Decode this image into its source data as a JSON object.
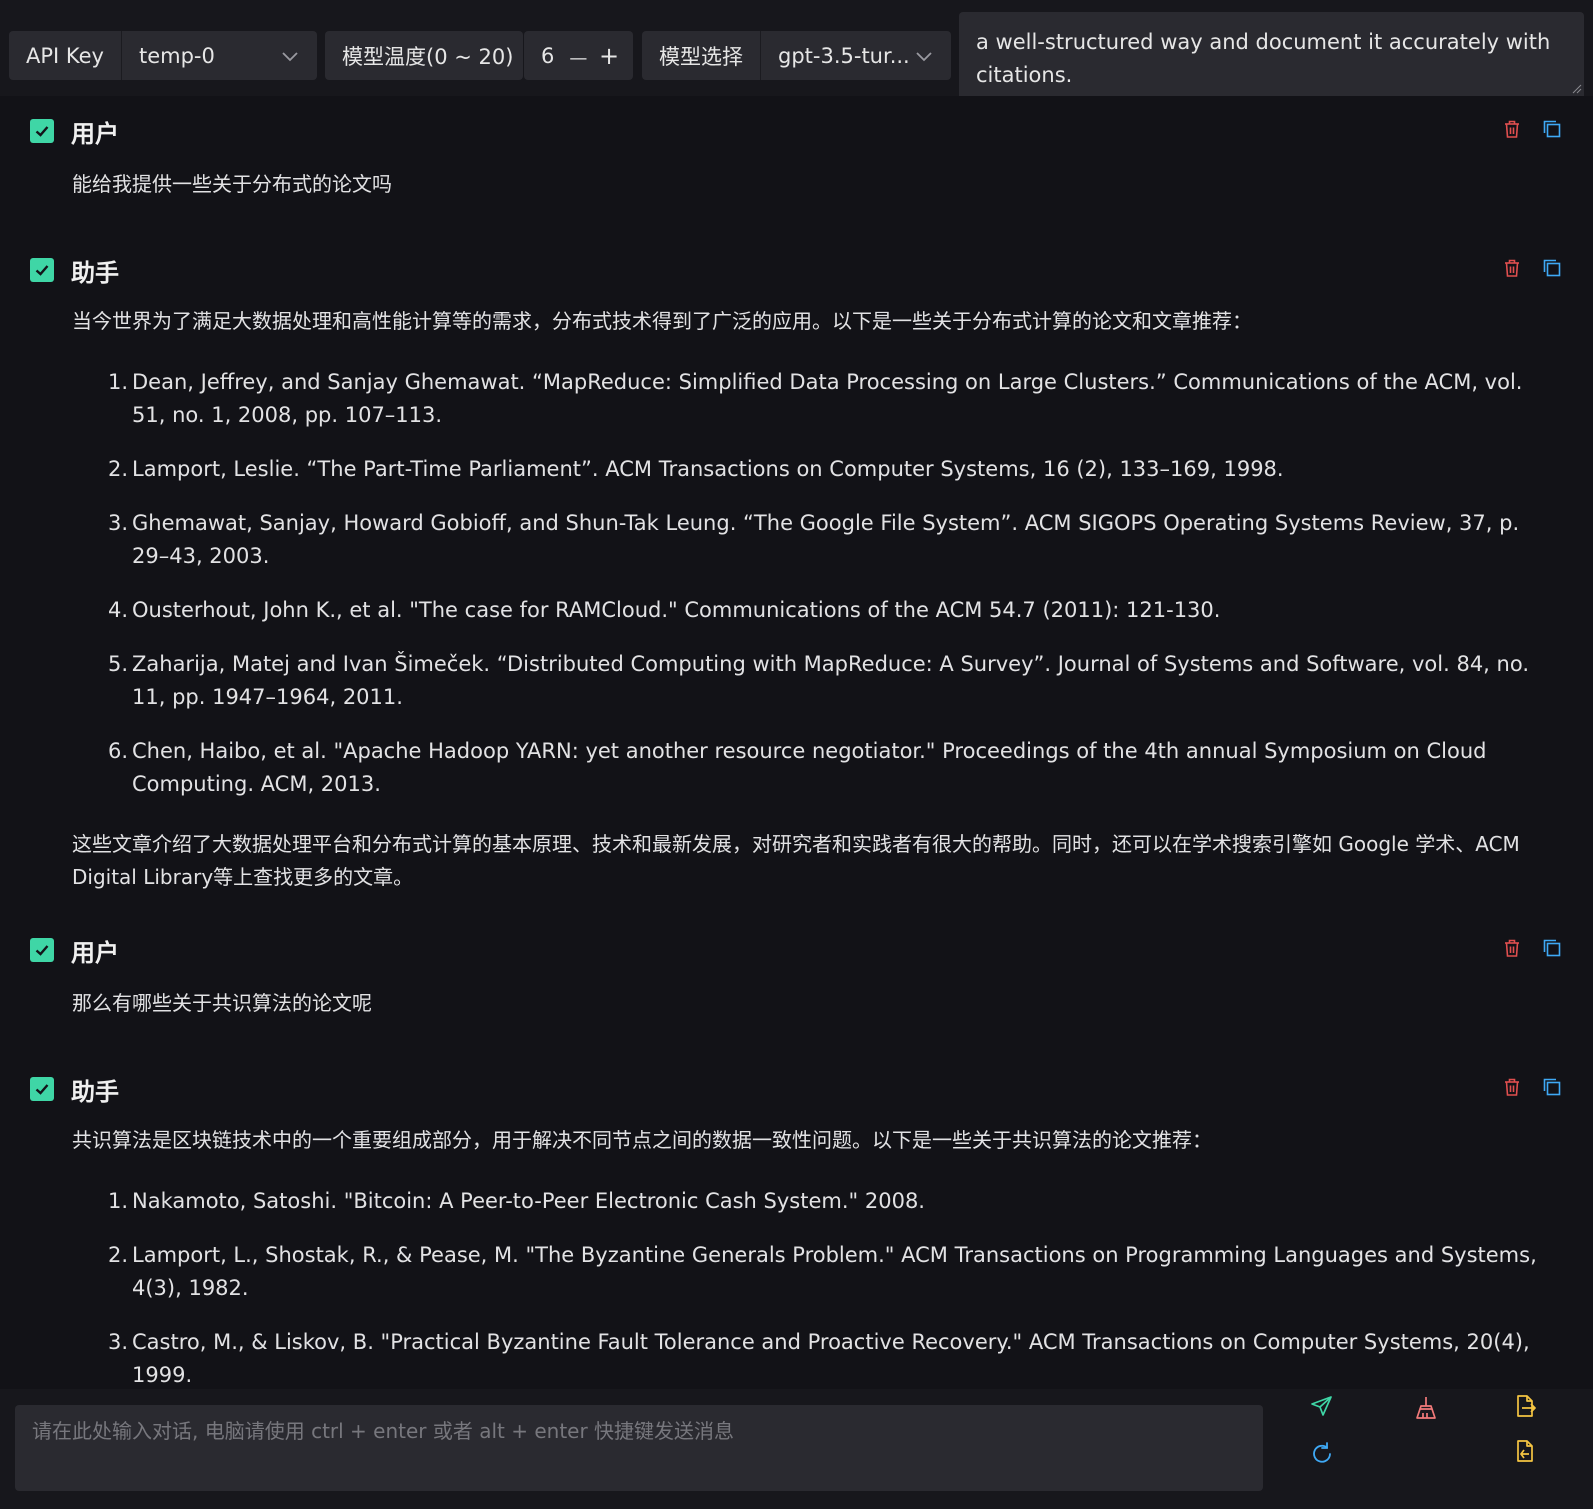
{
  "toolbar": {
    "api_key_label": "API Key",
    "api_key_value": "temp-0",
    "temperature_label": "模型温度(0 ~ 20)",
    "temperature_value": "6",
    "decrement": "—",
    "increment": "+",
    "model_label": "模型选择",
    "model_value": "gpt-3.5-tur..."
  },
  "system_prompt": {
    "visible_text": "a well-structured way and document it accurately with citations."
  },
  "messages": [
    {
      "role": "用户",
      "text": "能给我提供一些关于分布式的论文吗"
    },
    {
      "role": "助手",
      "intro": "当今世界为了满足大数据处理和高性能计算等的需求，分布式技术得到了广泛的应用。以下是一些关于分布式计算的论文和文章推荐：",
      "items": [
        "Dean, Jeffrey, and Sanjay Ghemawat. “MapReduce: Simplified Data Processing on Large Clusters.” Communications of the ACM, vol. 51, no. 1, 2008, pp. 107–113.",
        "Lamport, Leslie. “The Part-Time Parliament”. ACM Transactions on Computer Systems, 16 (2), 133–169, 1998.",
        "Ghemawat, Sanjay, Howard Gobioff, and Shun-Tak Leung. “The Google File System”. ACM SIGOPS Operating Systems Review, 37, p. 29–43, 2003.",
        "Ousterhout, John K., et al. \"The case for RAMCloud.\" Communications of the ACM 54.7 (2011): 121-130.",
        "Zaharija, Matej and Ivan Šimeček. “Distributed Computing with MapReduce: A Survey”. Journal of Systems and Software, vol. 84, no. 11, pp. 1947–1964, 2011.",
        "Chen, Haibo, et al. \"Apache Hadoop YARN: yet another resource negotiator.\" Proceedings of the 4th annual Symposium on Cloud Computing. ACM, 2013."
      ],
      "outro": "这些文章介绍了大数据处理平台和分布式计算的基本原理、技术和最新发展，对研究者和实践者有很大的帮助。同时，还可以在学术搜索引擎如 Google 学术、ACM Digital Library等上查找更多的文章。"
    },
    {
      "role": "用户",
      "text": "那么有哪些关于共识算法的论文呢"
    },
    {
      "role": "助手",
      "intro": "共识算法是区块链技术中的一个重要组成部分，用于解决不同节点之间的数据一致性问题。以下是一些关于共识算法的论文推荐：",
      "items": [
        "Nakamoto, Satoshi. \"Bitcoin: A Peer-to-Peer Electronic Cash System.\" 2008.",
        "Lamport, L., Shostak, R., & Pease, M. \"The Byzantine Generals Problem.\" ACM Transactions on Programming Languages and Systems, 4(3), 1982.",
        "Castro, M., & Liskov, B. \"Practical Byzantine Fault Tolerance and Proactive Recovery.\" ACM Transactions on Computer Systems, 20(4), 1999."
      ]
    }
  ],
  "input": {
    "placeholder": "请在此处输入对话, 电脑请使用 ctrl + enter 或者 alt + enter 快捷键发送消息"
  },
  "colors": {
    "background": "#121217",
    "accent": "#3fd6a6",
    "delete": "#e04f4f",
    "copy": "#3fa9f5",
    "send": "#3fd6a6",
    "clear": "#f27a7a",
    "export": "#f5c542"
  },
  "icons": {
    "send": "send-icon",
    "clear": "broom-icon",
    "export": "file-export-icon",
    "refresh": "refresh-icon",
    "import": "file-import-icon",
    "delete": "trash-icon",
    "copy": "copy-icon"
  }
}
